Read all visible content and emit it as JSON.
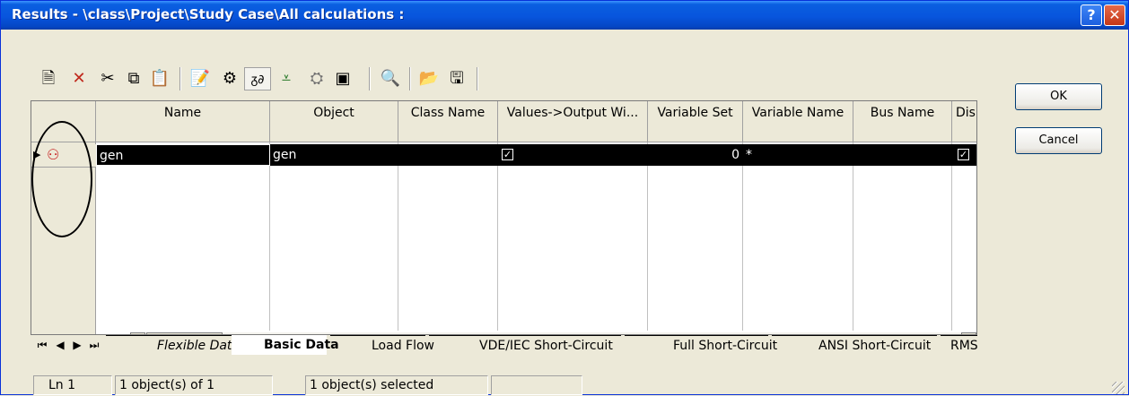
{
  "window": {
    "title": "Results - \\class\\Project\\Study Case\\All calculations :",
    "help_label": "?",
    "close_label": "✕"
  },
  "toolbar": {
    "icons": [
      "new-object-icon",
      "delete-icon",
      "cut-icon",
      "copy-icon",
      "paste-icon",
      "edit-icon",
      "gear-icon",
      "view-icon",
      "filter-icon",
      "tree-icon",
      "new-window-icon",
      "find-icon",
      "open-icon",
      "save-icon"
    ]
  },
  "buttons": {
    "ok": "OK",
    "cancel": "Cancel"
  },
  "table": {
    "columns": [
      "Name",
      "Object",
      "Class Name",
      "Values->Output Wi...",
      "Variable Set",
      "Variable Name",
      "Bus Name",
      "Displa"
    ],
    "rows": [
      {
        "name": "gen",
        "object": "gen",
        "class_name": "",
        "values_output": true,
        "variable_set": "0",
        "variable_name": "*",
        "bus_name": "",
        "display": true
      }
    ]
  },
  "tabs": [
    "Flexible Data",
    "Basic Data",
    "Load Flow",
    "VDE/IEC Short-Circuit",
    "Full Short-Circuit",
    "ANSI Short-Circuit",
    "RMS"
  ],
  "active_tab": "Basic Data",
  "status": {
    "line": "Ln 1",
    "objects": "1 object(s) of 1",
    "selected": "1 object(s) selected"
  }
}
